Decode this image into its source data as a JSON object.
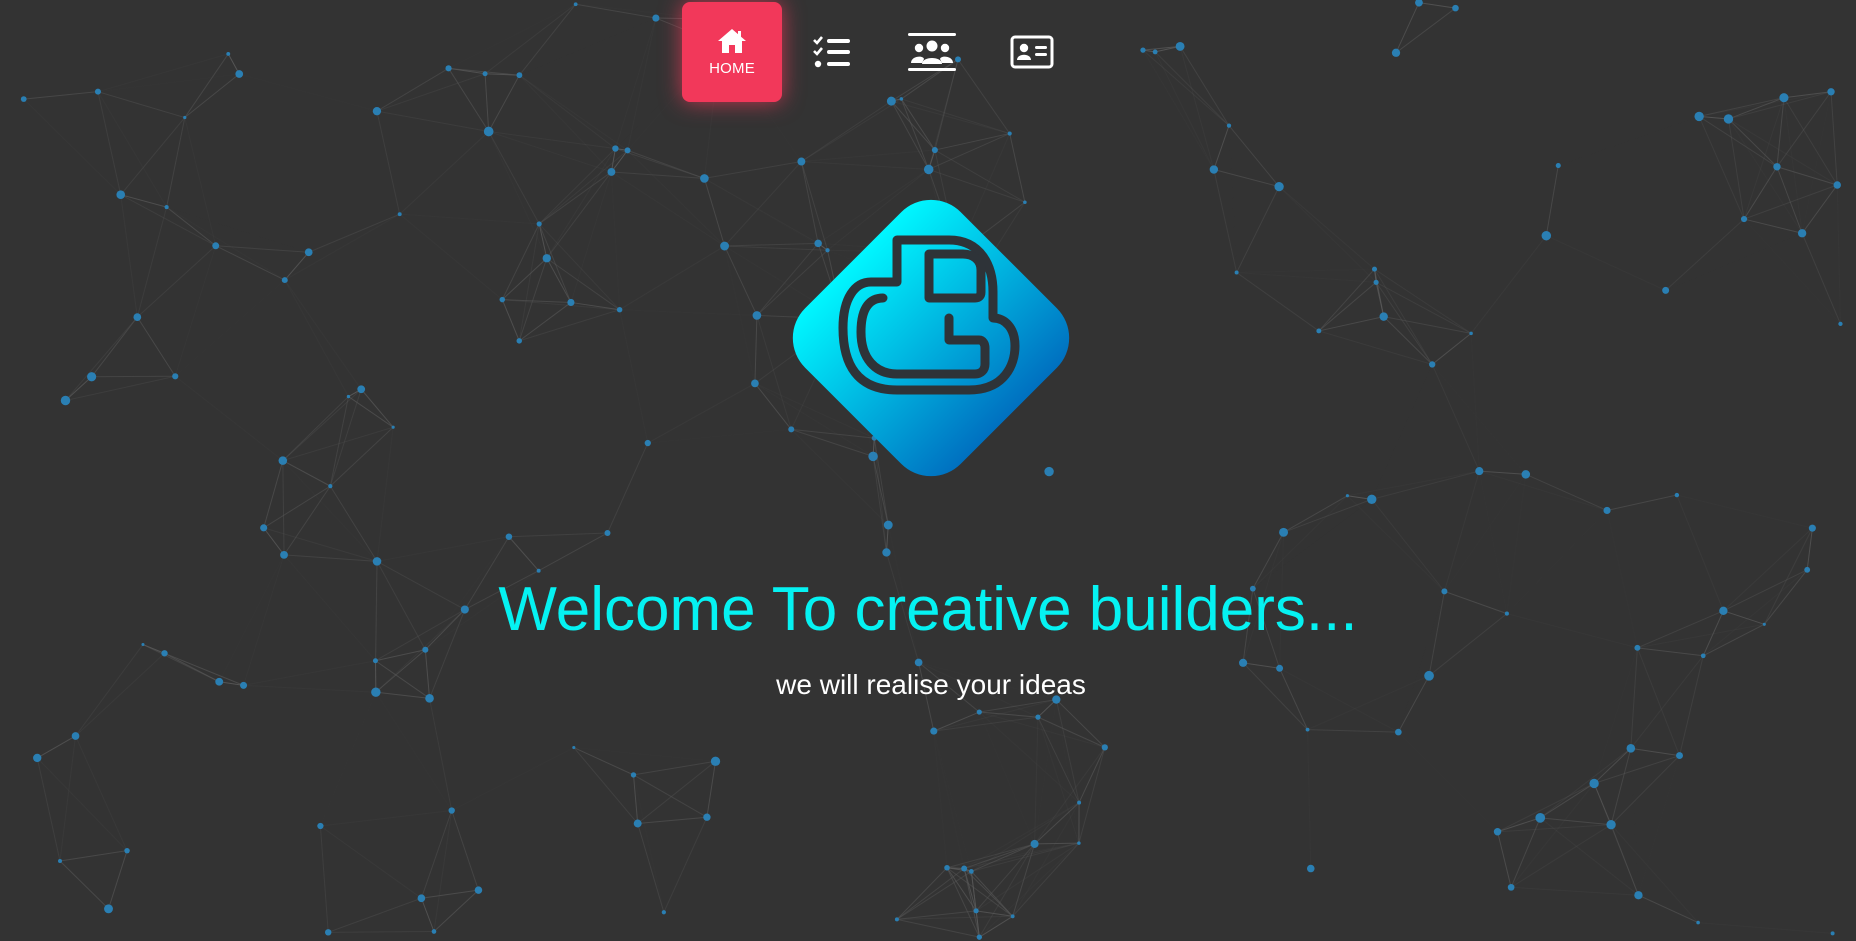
{
  "nav": {
    "items": [
      {
        "label": "HOME",
        "icon": "home-icon",
        "active": true
      },
      {
        "label": "",
        "icon": "checklist-icon",
        "active": false
      },
      {
        "label": "",
        "icon": "team-icon",
        "active": false
      },
      {
        "label": "",
        "icon": "contact-card-icon",
        "active": false
      }
    ]
  },
  "hero": {
    "logo_icon": "c3-logo-icon",
    "headline": "Welcome To creative builders...",
    "subline": "we will realise your ideas"
  },
  "colors": {
    "background": "#333333",
    "accent": "#f2385a",
    "headline": "#05f2f2",
    "logo_gradient_start": "#00f7ff",
    "logo_gradient_end": "#0070c0",
    "network_node": "#2a7fb3",
    "network_line": "#6b6b6b"
  }
}
